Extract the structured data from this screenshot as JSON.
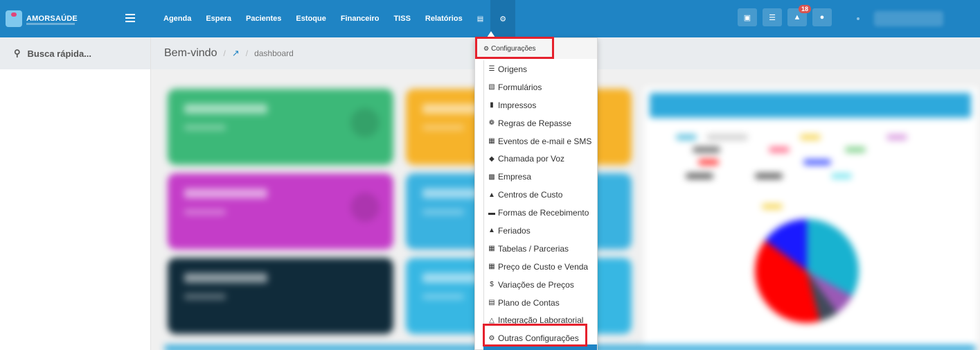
{
  "brand": {
    "name": "AMORSAÚDE"
  },
  "nav": {
    "items": [
      "Agenda",
      "Espera",
      "Pacientes",
      "Estoque",
      "Financeiro",
      "TISS",
      "Relatórios"
    ],
    "db_icon": "database-icon",
    "gear_icon": "gear-icon"
  },
  "topbar": {
    "notification_count": "18"
  },
  "sidebar": {
    "search_label": "Busca rápida..."
  },
  "breadcrumb": {
    "title": "Bem-vindo",
    "icon": "chart-line-icon",
    "page": "dashboard"
  },
  "menu": {
    "header": "Configurações",
    "items": [
      {
        "label": "Origens",
        "icon": "list-icon"
      },
      {
        "label": "Formulários",
        "icon": "bar-chart-icon"
      },
      {
        "label": "Impressos",
        "icon": "file-icon"
      },
      {
        "label": "Regras de Repasse",
        "icon": "route-icon"
      },
      {
        "label": "Eventos de e-mail e SMS",
        "icon": "calendar-icon"
      },
      {
        "label": "Chamada por Voz",
        "icon": "speaker-icon"
      },
      {
        "label": "Empresa",
        "icon": "building-icon"
      },
      {
        "label": "Centros de Custo",
        "icon": "sitemap-icon"
      },
      {
        "label": "Formas de Recebimento",
        "icon": "credit-card-icon"
      },
      {
        "label": "Feriados",
        "icon": "road-icon"
      },
      {
        "label": "Tabelas / Parcerias",
        "icon": "table-icon"
      },
      {
        "label": "Preço de Custo e Venda",
        "icon": "table-icon"
      },
      {
        "label": "Variações de Preços",
        "icon": "dollar-icon"
      },
      {
        "label": "Plano de Contas",
        "icon": "list-alt-icon"
      },
      {
        "label": "Integração Laboratorial",
        "icon": "flask-icon"
      },
      {
        "label": "Outras Configurações",
        "icon": "gears-icon"
      }
    ]
  },
  "colors": {
    "brand_blue": "#1f84c4",
    "highlight_red": "#e5212d"
  }
}
